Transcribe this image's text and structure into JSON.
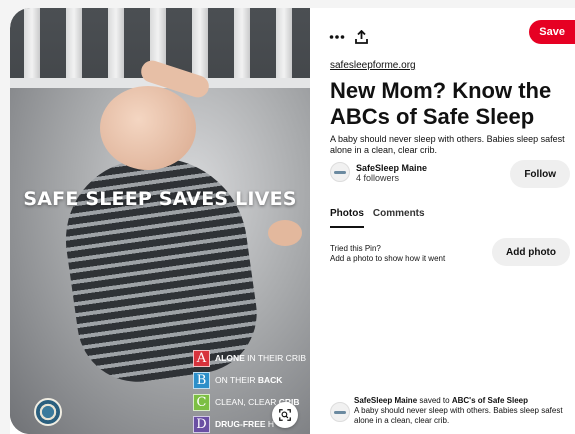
{
  "image": {
    "headline": "SAFE SLEEP SAVES LIVES",
    "abc_items": [
      {
        "letter": "A",
        "color": "#d7323c",
        "pre": "",
        "bold": "ALONE",
        "post": " IN THEIR CRIB"
      },
      {
        "letter": "B",
        "color": "#2c8fc9",
        "pre": "ON THEIR ",
        "bold": "BACK",
        "post": ""
      },
      {
        "letter": "C",
        "color": "#7cbf43",
        "pre": "CLEAN, CLEAR ",
        "bold": "CRIB",
        "post": ""
      },
      {
        "letter": "D",
        "color": "#6a4fa3",
        "pre": "",
        "bold": "DRUG-FREE",
        "post": " H"
      }
    ]
  },
  "toolbar": {
    "more_icon": "more-horizontal-icon",
    "share_icon": "share-icon",
    "save_label": "Save"
  },
  "pin": {
    "source": "safesleepforme.org",
    "title": "New Mom? Know the ABCs of Safe Sleep",
    "description": "A baby should never sleep with others. Babies sleep safest alone in a clean, clear crib."
  },
  "creator": {
    "name": "SafeSleep Maine",
    "followers": "4 followers",
    "follow_label": "Follow"
  },
  "tabs": [
    {
      "label": "Photos",
      "active": true
    },
    {
      "label": "Comments",
      "active": false
    }
  ],
  "tried": {
    "line1": "Tried this Pin?",
    "line2": "Add a photo to show how it went",
    "button": "Add photo"
  },
  "activity": {
    "user": "SafeSleep Maine",
    "action": " saved to ",
    "board": "ABC's of Safe Sleep",
    "description": "A baby should never sleep with others. Babies sleep safest alone in a clean, clear crib."
  },
  "colors": {
    "brand_red": "#e60023",
    "button_gray": "#efefef"
  }
}
